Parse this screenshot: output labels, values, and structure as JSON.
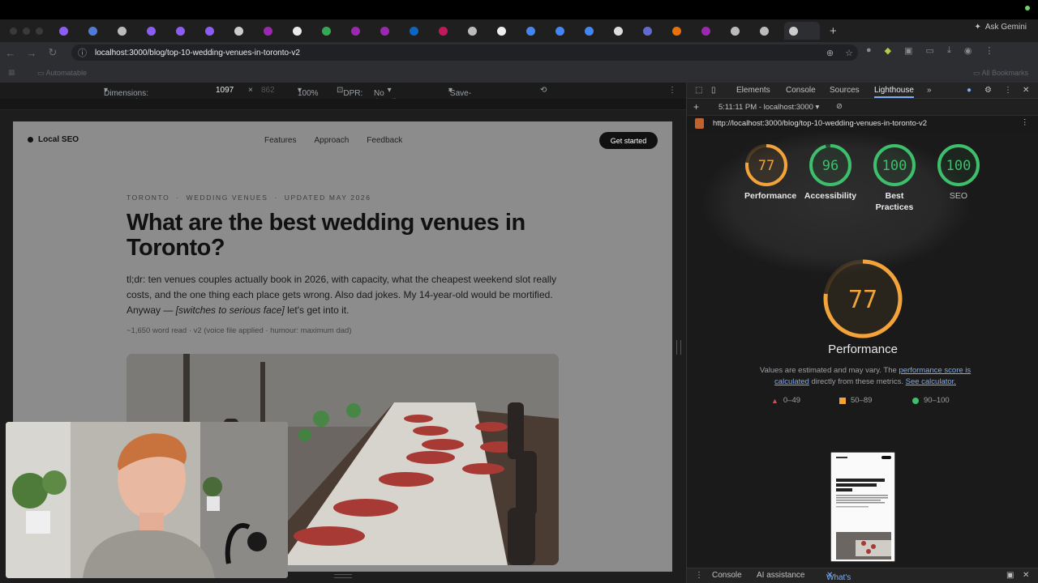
{
  "browser": {
    "gemini_label": "Ask Gemini",
    "url": "localhost:3000/blog/top-10-wedding-venues-in-toronto-v2",
    "bookmark_automatable": "Automatable",
    "bookmark_all": "All Bookmarks"
  },
  "device_toolbar": {
    "dimensions_label": "Dimensions: Responsive",
    "width": "1097",
    "times": "×",
    "height": "862",
    "zoom": "100%",
    "dpr": "DPR:",
    "throttle": "No throttling",
    "save_data": "'Save-Data': default"
  },
  "page": {
    "logo": "Local SEO",
    "nav": [
      "Features",
      "Approach",
      "Feedback"
    ],
    "cta": "Get started",
    "eyebrow": "TORONTO  ·  WEDDING VENUES  ·  UPDATED MAY 2026",
    "title": "What are the best wedding venues in Toronto?",
    "lede_a": "tl;dr: ten venues couples actually book in 2026, with capacity, what the cheapest weekend slot really costs, and the one thing each place gets wrong. Also dad jokes. My 14-year-old would be mortified. Anyway — ",
    "lede_em": "[switches to serious face]",
    "lede_b": " let's get into it.",
    "meta": "~1,650 word read · v2 (voice file applied · humour: maximum dad)"
  },
  "devtools": {
    "tabs": [
      "Elements",
      "Console",
      "Sources",
      "Lighthouse"
    ],
    "report_time": "5:11:11 PM - localhost:3000",
    "report_url": "http://localhost:3000/blog/top-10-wedding-venues-in-toronto-v2",
    "scores": [
      {
        "label": "Performance",
        "value": 77,
        "color": "#f2a33a"
      },
      {
        "label": "Accessibility",
        "value": 96,
        "color": "#3dbf6c"
      },
      {
        "label": "Best Practices",
        "value": 100,
        "color": "#3dbf6c"
      },
      {
        "label": "SEO",
        "value": 100,
        "color": "#3dbf6c"
      }
    ],
    "big_score": 77,
    "big_title": "Performance",
    "disclaimer_a": "Values are estimated and may vary. The ",
    "disclaimer_link1": "performance score is calculated",
    "disclaimer_b": " directly from these metrics. ",
    "disclaimer_link2": "See calculator.",
    "legend": [
      "0–49",
      "50–89",
      "90–100"
    ],
    "bottom_tabs": [
      "Console",
      "AI assistance",
      "What's new"
    ]
  }
}
